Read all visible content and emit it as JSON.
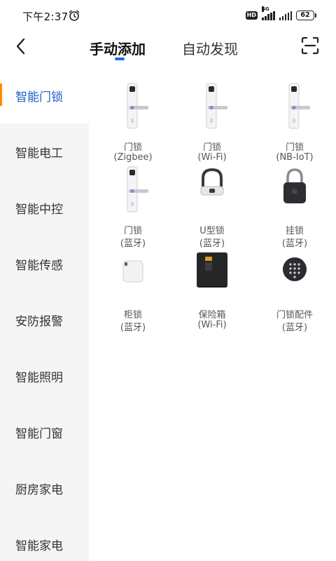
{
  "status_bar": {
    "time": "下午2:37",
    "alarm_icon": "alarm-clock-icon",
    "hd_label": "HD",
    "network_label": "4G",
    "battery": "62"
  },
  "header": {
    "back_icon": "back-chevron-icon",
    "tabs": [
      {
        "label": "手动添加",
        "active": true
      },
      {
        "label": "自动发现",
        "active": false
      }
    ],
    "scan_icon": "scan-icon",
    "accent_color": "#1f6fe0"
  },
  "sidebar": {
    "active_marker_color": "#ff8a00",
    "active_text_color": "#1f5ec4",
    "items": [
      {
        "label": "智能门锁",
        "active": true
      },
      {
        "label": "智能电工"
      },
      {
        "label": "智能中控"
      },
      {
        "label": "智能传感"
      },
      {
        "label": "安防报警"
      },
      {
        "label": "智能照明"
      },
      {
        "label": "智能门窗"
      },
      {
        "label": "厨房家电"
      },
      {
        "label": "智能家电"
      }
    ]
  },
  "devices": [
    {
      "name": "门锁",
      "sub": "(Zigbee)",
      "icon": "door-lock-icon"
    },
    {
      "name": "门锁",
      "sub": "(Wi-Fi)",
      "icon": "door-lock-icon"
    },
    {
      "name": "门锁",
      "sub": "(NB-IoT)",
      "icon": "door-lock-icon"
    },
    {
      "name": "门锁",
      "sub": "(蓝牙)",
      "icon": "door-lock-icon"
    },
    {
      "name": "U型锁",
      "sub": "(蓝牙)",
      "icon": "u-lock-icon"
    },
    {
      "name": "挂锁",
      "sub": "(蓝牙)",
      "icon": "padlock-icon"
    },
    {
      "name": "柜锁",
      "sub": "(蓝牙)",
      "icon": "cabinet-lock-icon"
    },
    {
      "name": "保险箱",
      "sub": "(Wi-Fi)",
      "icon": "safe-box-icon"
    },
    {
      "name": "门锁配件",
      "sub": "(蓝牙)",
      "icon": "keypad-icon"
    }
  ]
}
